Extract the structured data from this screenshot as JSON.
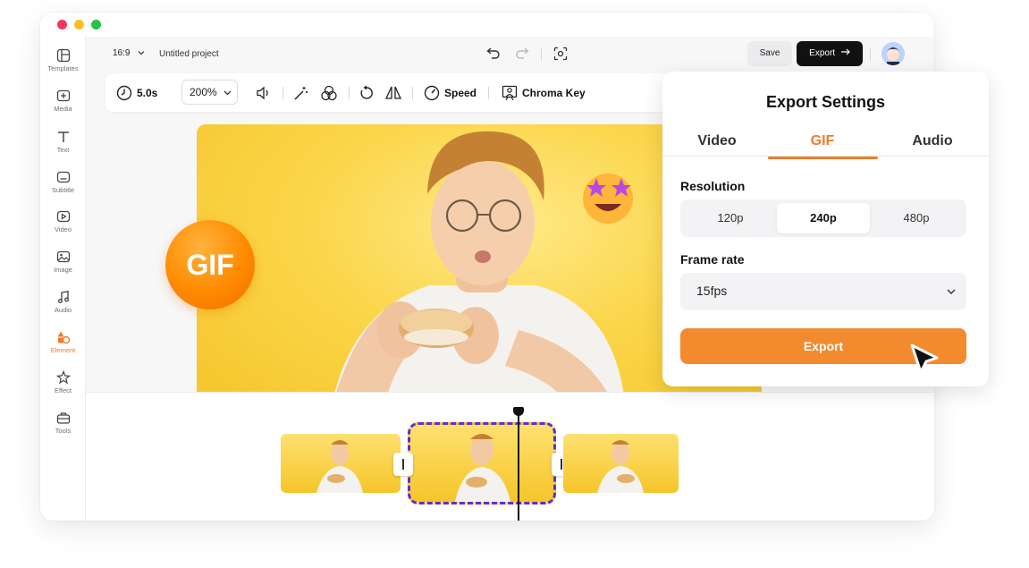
{
  "editor": {
    "aspect_ratio": "16:9",
    "project_name": "Untitled project",
    "save_label": "Save",
    "export_label": "Export"
  },
  "sidebar": {
    "items": [
      {
        "label": "Templates",
        "icon": "templates-icon"
      },
      {
        "label": "Media",
        "icon": "media-icon"
      },
      {
        "label": "Text",
        "icon": "text-icon"
      },
      {
        "label": "Subtitle",
        "icon": "subtitle-icon"
      },
      {
        "label": "Video",
        "icon": "video-icon"
      },
      {
        "label": "Image",
        "icon": "image-icon"
      },
      {
        "label": "Audio",
        "icon": "audio-icon"
      },
      {
        "label": "Element",
        "icon": "element-icon",
        "active": true
      },
      {
        "label": "Effect",
        "icon": "effect-icon"
      },
      {
        "label": "Tools",
        "icon": "tools-icon"
      }
    ]
  },
  "toolbar": {
    "duration": "5.0s",
    "zoom": "200%",
    "speed_label": "Speed",
    "chroma_label": "Chroma Key"
  },
  "canvas": {
    "badge_text": "GIF"
  },
  "export_settings": {
    "title": "Export Settings",
    "tabs": [
      "Video",
      "GIF",
      "Audio"
    ],
    "active_tab": "GIF",
    "resolution_label": "Resolution",
    "resolutions": [
      "120p",
      "240p",
      "480p"
    ],
    "selected_resolution": "240p",
    "frame_rate_label": "Frame rate",
    "frame_rate_value": "15fps",
    "export_button": "Export"
  },
  "colors": {
    "accent": "#f07c2a",
    "canvas_bg": "#fbd64a",
    "clip_selection": "#5b2fd6"
  }
}
